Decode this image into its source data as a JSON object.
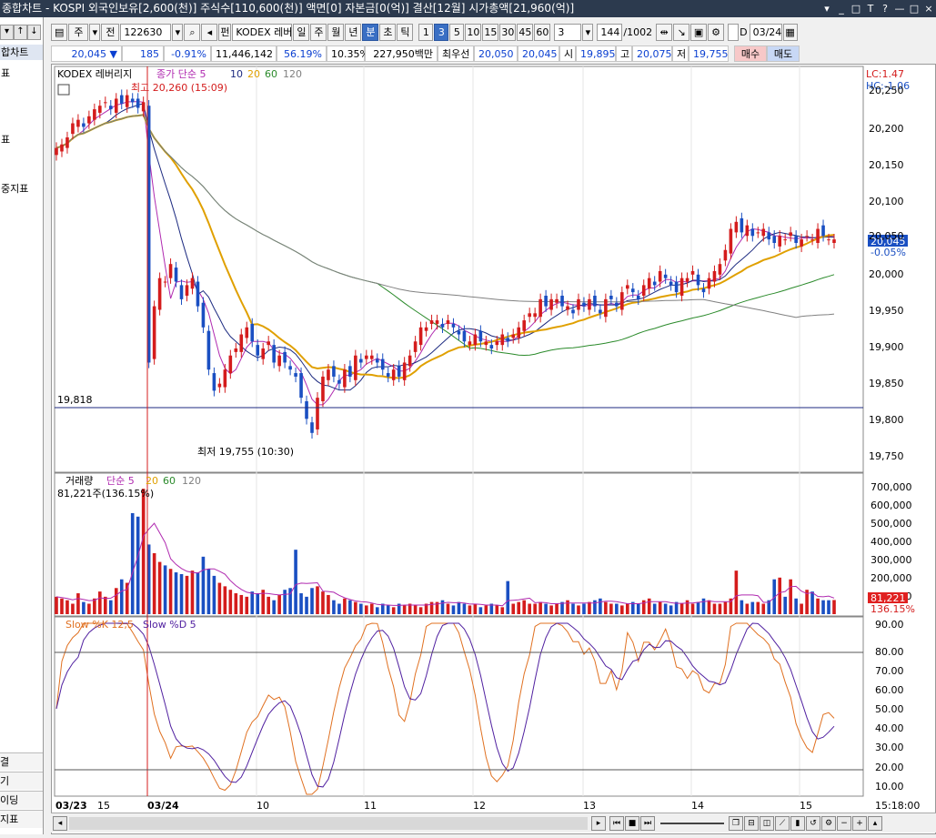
{
  "window": {
    "title": "종합차트 - KOSPI 외국인보유[2,600(천)] 주식수[110,600(천)] 액면[0] 자본금[0(억)] 결산[12월] 시가총액[21,960(억)]",
    "buttons": [
      "▾",
      "_",
      "□",
      "T",
      "?",
      "—",
      "□",
      "×"
    ]
  },
  "left_panel": {
    "top_buttons": [
      "▾",
      "↑",
      "↓"
    ],
    "items": [
      "합차트",
      "표",
      "표",
      "중지표"
    ],
    "bottom_items": [
      "결",
      "기",
      "이딩",
      "지표"
    ]
  },
  "toolbar": {
    "period_label": "주",
    "series_label": "전",
    "code_value": "122630",
    "name_value": "KODEX 레버",
    "prefix": "펀",
    "periods": [
      "일",
      "주",
      "월",
      "년",
      "분",
      "초",
      "틱"
    ],
    "selected_period": "분",
    "intervals": [
      "1",
      "3",
      "5",
      "10",
      "15",
      "30",
      "45",
      "60"
    ],
    "selected_interval": "3",
    "interval_input": "3",
    "count": "144",
    "count_total": "/1002",
    "date_value": "03/24",
    "d_label": "D"
  },
  "quote": {
    "price": "20,045",
    "change_arrow": "▼",
    "change": "185",
    "change_pct": "-0.91%",
    "volume": "11,446,142",
    "vol_ratio": "56.19%",
    "turnover": "10.35%",
    "amount": "227,950백만",
    "best_label": "최우선",
    "bid": "20,050",
    "ask": "20,045",
    "open_label": "시",
    "open": "19,895",
    "high_label": "고",
    "high": "20,075",
    "low_label": "저",
    "low": "19,755",
    "buy_button": "매수",
    "sell_button": "매도"
  },
  "price_panel": {
    "legend_name": "KODEX 레버리지",
    "legend_ma": "종가 단순 5",
    "legend_ma_periods": [
      "10",
      "20",
      "60",
      "120"
    ],
    "high_note": "최고 20,260 (15:09)",
    "low_note": "최저 19,755 (10:30)",
    "hline_label": "19,818",
    "lc": "LC:1.47",
    "hc": "HC:-1.06",
    "last_value": "20,045",
    "last_pct": "-0.05%",
    "y_ticks": [
      "20,250",
      "20,200",
      "20,150",
      "20,100",
      "20,050",
      "20,000",
      "19,950",
      "19,900",
      "19,850",
      "19,800",
      "19,750"
    ]
  },
  "volume_panel": {
    "legend_name": "거래량",
    "legend_ma": "단순 5",
    "legend_ma_periods": [
      "20",
      "60",
      "120"
    ],
    "last_note": "81,221주(136.15%)",
    "last_value": "81,221",
    "last_pct": "136.15%",
    "y_ticks": [
      "700,000",
      "600,000",
      "500,000",
      "400,000",
      "300,000",
      "200,000",
      "100,000"
    ]
  },
  "stoch_panel": {
    "legend_k": "Slow %K 12,5",
    "legend_d": "Slow %D 5",
    "y_ticks": [
      "90.00",
      "80.00",
      "70.00",
      "60.00",
      "50.00",
      "40.00",
      "30.00",
      "20.00",
      "10.00"
    ]
  },
  "x_axis": {
    "labels": [
      "03/23",
      "15",
      "03/24",
      "10",
      "11",
      "12",
      "13",
      "14",
      "15"
    ],
    "time": "15:18:00"
  },
  "colors": {
    "up": "#d41c1c",
    "down": "#1a4fc2",
    "ma5": "#b02ab0",
    "ma10": "#1c2a80",
    "ma20": "#e0a000",
    "ma60": "#2a8a2a",
    "ma120": "#808080",
    "accent": "#3a6fc4"
  },
  "chart_data": {
    "type": "candlestick",
    "x_start": "03/23 15:00",
    "interval_minutes": 3,
    "ylim": [
      19740,
      20265
    ],
    "ma_lines": [
      "5",
      "10",
      "20",
      "60",
      "120"
    ],
    "close_series": [
      20175,
      20180,
      20190,
      20210,
      20215,
      20205,
      20220,
      20230,
      20235,
      20240,
      20230,
      20245,
      20238,
      20250,
      20240,
      20232,
      20240,
      19870,
      19950,
      19990,
      19985,
      20010,
      19985,
      19960,
      19980,
      19990,
      19950,
      19920,
      19860,
      19830,
      19840,
      19860,
      19880,
      19890,
      19910,
      19920,
      19900,
      19880,
      19890,
      19900,
      19870,
      19880,
      19870,
      19860,
      19850,
      19820,
      19790,
      19770,
      19820,
      19850,
      19860,
      19850,
      19840,
      19860,
      19850,
      19880,
      19870,
      19880,
      19880,
      19870,
      19860,
      19850,
      19860,
      19850,
      19870,
      19880,
      19900,
      19920,
      19920,
      19930,
      19930,
      19920,
      19930,
      19920,
      19910,
      19900,
      19900,
      19910,
      19900,
      19900,
      19890,
      19900,
      19910,
      19900,
      19910,
      19920,
      19930,
      19940,
      19940,
      19960,
      19950,
      19960,
      19960,
      19950,
      19950,
      19940,
      19960,
      19950,
      19960,
      19950,
      19940,
      19960,
      19960,
      19950,
      19970,
      19980,
      19970,
      19960,
      19980,
      19990,
      19980,
      20000,
      19990,
      19980,
      19970,
      19990,
      19990,
      20000,
      19980,
      19970,
      19990,
      20000,
      20010,
      20030,
      20060,
      20070,
      20055,
      20065,
      20050,
      20055,
      20060,
      20045,
      20040,
      20050,
      20045,
      20055,
      20040,
      20045,
      20050,
      20045,
      20060,
      20050,
      20045,
      20045
    ],
    "volume_series": [
      100000,
      90000,
      80000,
      60000,
      120000,
      70000,
      60000,
      90000,
      130000,
      100000,
      80000,
      150000,
      200000,
      180000,
      580000,
      560000,
      720000,
      400000,
      350000,
      300000,
      280000,
      260000,
      240000,
      230000,
      220000,
      250000,
      240000,
      330000,
      260000,
      220000,
      180000,
      160000,
      140000,
      120000,
      110000,
      100000,
      130000,
      120000,
      140000,
      100000,
      80000,
      110000,
      140000,
      150000,
      370000,
      120000,
      100000,
      150000,
      160000,
      130000,
      110000,
      80000,
      60000,
      90000,
      80000,
      70000,
      60000,
      50000,
      60000,
      40000,
      60000,
      50000,
      40000,
      60000,
      50000,
      60000,
      50000,
      40000,
      60000,
      70000,
      70000,
      80000,
      60000,
      50000,
      70000,
      60000,
      50000,
      60000,
      40000,
      50000,
      60000,
      50000,
      40000,
      190000,
      60000,
      70000,
      80000,
      60000,
      60000,
      70000,
      60000,
      50000,
      60000,
      70000,
      80000,
      60000,
      50000,
      60000,
      70000,
      80000,
      90000,
      70000,
      60000,
      60000,
      50000,
      60000,
      70000,
      60000,
      80000,
      90000,
      60000,
      70000,
      60000,
      50000,
      70000,
      60000,
      80000,
      60000,
      70000,
      90000,
      80000,
      60000,
      60000,
      70000,
      90000,
      250000,
      80000,
      60000,
      70000,
      70000,
      60000,
      80000,
      200000,
      210000,
      100000,
      200000,
      90000,
      60000,
      140000,
      130000,
      90000,
      80000,
      80000,
      81221
    ]
  }
}
